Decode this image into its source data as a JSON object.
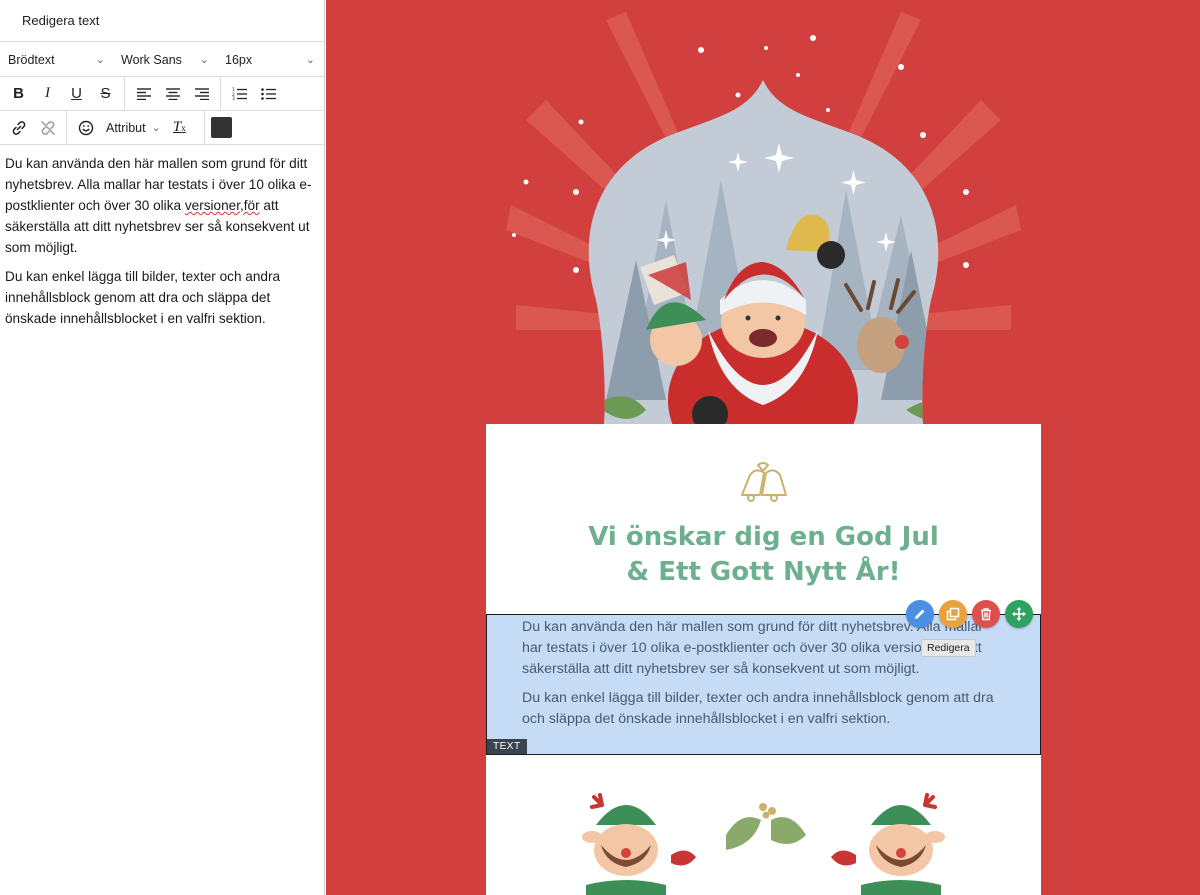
{
  "panel": {
    "title": "Redigera text",
    "format_select": "Brödtext",
    "font_select": "Work Sans",
    "size_select": "16px",
    "attribute_select": "Attribut",
    "text_color": "#333333",
    "paragraph1_before": "Du kan använda den här mallen som grund för ditt nyhetsbrev. Alla mallar har testats i över 10 olika e-postklienter och över 30 olika ",
    "paragraph1_misspelled": "versioner,för",
    "paragraph1_after": " att säkerställa att ditt nyhetsbrev ser så konsekvent ut som möjligt.",
    "paragraph2": "Du kan enkel lägga till bilder, texter och andra innehållsblock genom att dra och släppa det önskade innehållsblocket i en valfri sektion."
  },
  "preview": {
    "greeting_line1": "Vi önskar dig en God Jul",
    "greeting_line2": "& Ett Gott Nytt År!",
    "text_p1": "Du kan använda den här mallen som grund för ditt nyhetsbrev. Alla mallar har testats i över 10 olika e-postklienter och över 30 olika versioner,för att säkerställa att ditt nyhetsbrev ser så konsekvent ut som möjligt.",
    "text_p2": "Du kan enkel lägga till bilder, texter och andra innehållsblock genom att dra och släppa det önskade innehållsblocket i en valfri sektion.",
    "block_tag": "TEXT",
    "tooltip": "Redigera",
    "colors": {
      "background": "#d1403e",
      "greeting": "#6cb08f",
      "selection": "#c6dbf6",
      "edit_action": "#4a8fe4",
      "copy_action": "#e9a23b",
      "delete_action": "#e04f4f",
      "move_action": "#2fa260"
    }
  }
}
